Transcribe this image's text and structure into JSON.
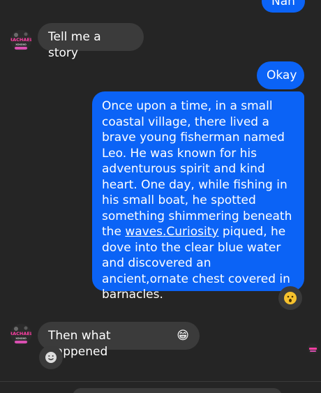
{
  "messages": {
    "top_partial_outgoing": "Nah",
    "incoming_1": "Tell me a story",
    "outgoing_okay": "Okay",
    "story_part_1": "Once upon a time, in a small coastal village, there lived a brave young fisherman named Leo. He was known for his adventurous spirit and kind heart. One day, while fishing in his small boat, he spotted something shimmering beneath the ",
    "story_link": "waves.Curiosity",
    "story_part_2": " piqued, he dove into the clear blue water and discovered an ancient,ornate chest covered in barnacles.",
    "incoming_2": "Then what happened",
    "incoming_2_emoji": "😁"
  },
  "avatar": {
    "name_line_1": "RACHAEL",
    "name_line_2": "xoxoxo"
  },
  "reactions": {
    "story_reaction_icon": "surprised-face",
    "add_reaction_icon": "smiley-outline"
  },
  "colors": {
    "background": "#252525",
    "outgoing_bubble": "#0b63f6",
    "incoming_bubble": "#3b3b3b",
    "reaction_bg": "#3a3a3a"
  }
}
